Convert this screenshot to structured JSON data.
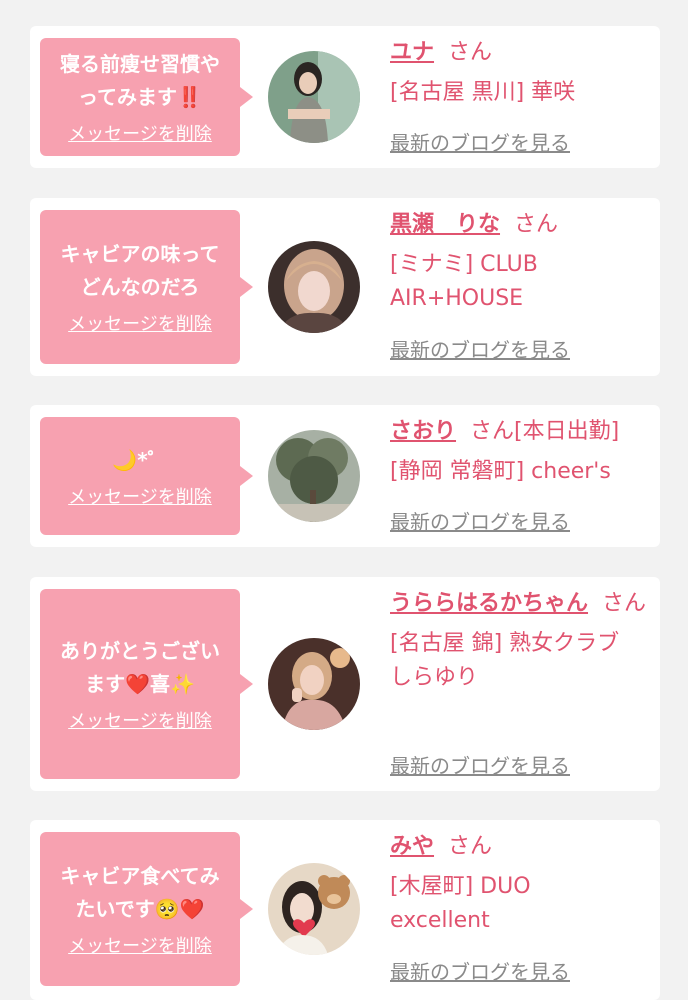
{
  "messages": [
    {
      "bubble_text": "寝る前痩せ習慣や\nってみます‼️",
      "delete_label": "メッセージを削除",
      "name": "ユナ",
      "honorific": "さん",
      "shop": "[名古屋 黒川] 華咲",
      "blog_label": "最新のブログを見る"
    },
    {
      "bubble_text": "キャビアの味って\nどんなのだろ",
      "delete_label": "メッセージを削除",
      "name": "黒瀬　りな",
      "honorific": "さん",
      "shop": "[ミナミ] CLUB\nAIR+HOUSE",
      "blog_label": "最新のブログを見る"
    },
    {
      "bubble_text": "🌙*゜",
      "delete_label": "メッセージを削除",
      "name": "さおり",
      "honorific": "さん[本日出勤]",
      "shop": "[静岡 常磐町] cheer's",
      "blog_label": "最新のブログを見る"
    },
    {
      "bubble_text": "ありがとうござい\nます❤️喜✨",
      "delete_label": "メッセージを削除",
      "name": "うららはるかちゃん",
      "honorific": "さん",
      "shop": "[名古屋 錦] 熟女クラブ\nしらゆり",
      "blog_label": "最新のブログを見る"
    },
    {
      "bubble_text": "キャビア食べてみ\nたいです🥺❤️",
      "delete_label": "メッセージを削除",
      "name": "みや",
      "honorific": "さん",
      "shop": "[木屋町] DUO\nexcellent",
      "blog_label": "最新のブログを見る"
    }
  ],
  "colors": {
    "accent_pink": "#e0536f",
    "bubble_pink": "#f7a1b0",
    "background": "#f2f2f2",
    "card": "#ffffff",
    "link_gray": "#8a8a8a"
  }
}
